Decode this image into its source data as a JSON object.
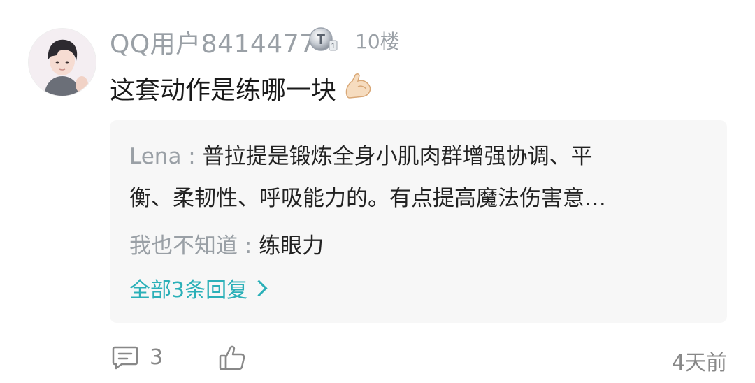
{
  "comment": {
    "username": "QQ用户8414477",
    "level_badge_letter": "T",
    "level_badge_number": "1",
    "floor": "10楼",
    "text": "这套动作是练哪一块",
    "emoji_icon": "flexed-biceps-icon"
  },
  "replies": [
    {
      "author": "Lena",
      "separator": " : ",
      "text_line1": "普拉提是锻炼全身小肌肉群增强协调、平",
      "text_line2": "衡、柔韧性、呼吸能力的。有点提高魔法伤害意…"
    },
    {
      "author": "我也不知道",
      "separator": " : ",
      "text_line1": "练眼力"
    }
  ],
  "all_replies_label": "全部3条回复",
  "footer": {
    "comment_icon": "comment-icon",
    "comment_count": "3",
    "like_icon": "thumbs-up-icon",
    "timestamp": "4天前"
  },
  "colors": {
    "accent": "#2bb0b8",
    "muted": "#9aa0a6",
    "text": "#1a1a1a",
    "reply_bg": "#f7f7f7"
  }
}
